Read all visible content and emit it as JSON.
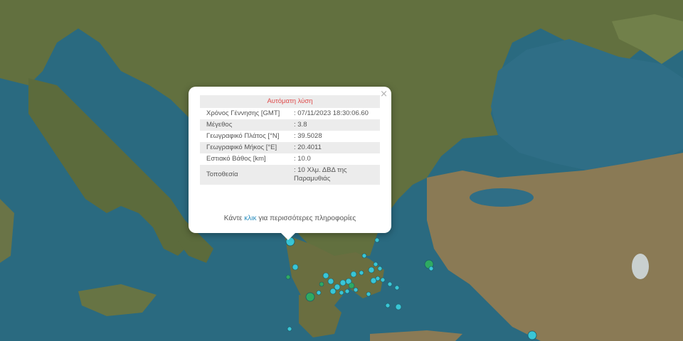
{
  "popup": {
    "title": "Αυτόματη λύση",
    "close_glyph": "×",
    "rows": [
      {
        "label": "Χρόνος Γέννησης [GMT]",
        "value": ": 07/11/2023 18:30:06.60"
      },
      {
        "label": "Μέγεθος",
        "value": ": 3.8"
      },
      {
        "label": "Γεωγραφικό Πλάτος [°N]",
        "value": ": 39.5028"
      },
      {
        "label": "Γεωγραφικό Μήκος [°E]",
        "value": ": 20.4011"
      },
      {
        "label": "Εστιακό Βάθος [km]",
        "value": ": 10.0"
      },
      {
        "label": "Τοποθεσία",
        "value": ": 10 Χλμ. ΔΒΔ της Παραμυθιάς"
      }
    ],
    "more_prefix": "Κάντε",
    "more_link": "κλικ",
    "more_suffix": "για περισσότερες πληροφορίες"
  },
  "colors": {
    "sea": "#2a6a80",
    "land": "#5f6e3e",
    "event_recent": "#39c6d6",
    "event_old": "#2eaa62",
    "title_red": "#e04b4b",
    "link": "#2b8fbf"
  }
}
